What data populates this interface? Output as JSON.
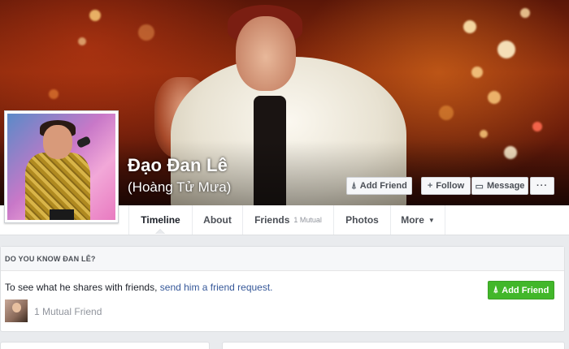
{
  "profile": {
    "name": "Đạo Đan Lê",
    "alternate_name": "(Hoàng Tử Mưa)"
  },
  "cover_actions": {
    "add_friend": {
      "icon": "add-person-icon",
      "glyph": "⍋",
      "label": "Add Friend"
    },
    "follow": {
      "icon": "plus-icon",
      "glyph": "+",
      "label": "Follow"
    },
    "message": {
      "icon": "message-icon",
      "glyph": "▭",
      "label": "Message"
    },
    "more": {
      "icon": "ellipsis-icon",
      "label": "···"
    }
  },
  "tabs": [
    {
      "label": "Timeline",
      "active": true
    },
    {
      "label": "About"
    },
    {
      "label": "Friends",
      "count": "1 Mutual"
    },
    {
      "label": "Photos"
    },
    {
      "label": "More",
      "caret": "▼"
    }
  ],
  "know_card": {
    "header": "DO YOU KNOW ĐAN LÊ?",
    "text": "To see what he shares with friends, ",
    "link": "send him a friend request.",
    "add_friend_label": "Add Friend",
    "mutual_text": "1 Mutual Friend"
  },
  "colors": {
    "link": "#365899",
    "add_friend_green": "#42b72a",
    "page_bg": "#e9ebee"
  }
}
